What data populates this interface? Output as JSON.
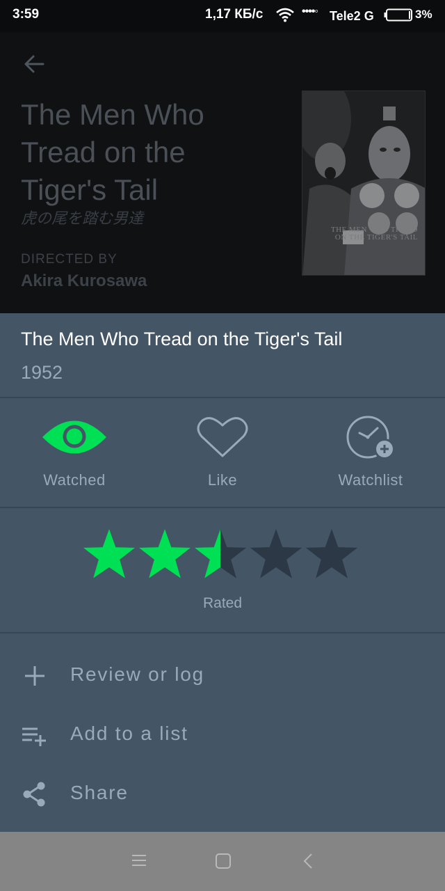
{
  "status_bar": {
    "time": "3:59",
    "speed": "1,17 КБ/с",
    "signal": "••••◦",
    "carrier": "Tele2 G",
    "battery": "3%"
  },
  "header": {
    "title": "The Men Who Tread on the Tiger's Tail",
    "original_title": "虎の尾を踏む男達",
    "directed_by_label": "DIRECTED BY",
    "director": "Akira Kurosawa",
    "poster_text": "THE MEN WHO TREAD ON THE TIGER'S TAIL"
  },
  "sheet": {
    "title": "The Men Who Tread on the Tiger's Tail",
    "year": "1952",
    "actions": [
      {
        "label": "Watched",
        "icon": "eye-icon",
        "active": true
      },
      {
        "label": "Like",
        "icon": "heart-icon",
        "active": false
      },
      {
        "label": "Watchlist",
        "icon": "clock-plus-icon",
        "active": false
      }
    ],
    "rating": {
      "value": 2.5,
      "max": 5,
      "label": "Rated"
    },
    "menu": [
      {
        "label": "Review or log",
        "icon": "plus-icon"
      },
      {
        "label": "Add to a list",
        "icon": "playlist-add-icon"
      },
      {
        "label": "Share",
        "icon": "share-icon"
      }
    ]
  },
  "colors": {
    "accent": "#00e054",
    "sheet_background": "#445566",
    "muted_text": "#99aabb",
    "star_empty": "#2c3845"
  }
}
